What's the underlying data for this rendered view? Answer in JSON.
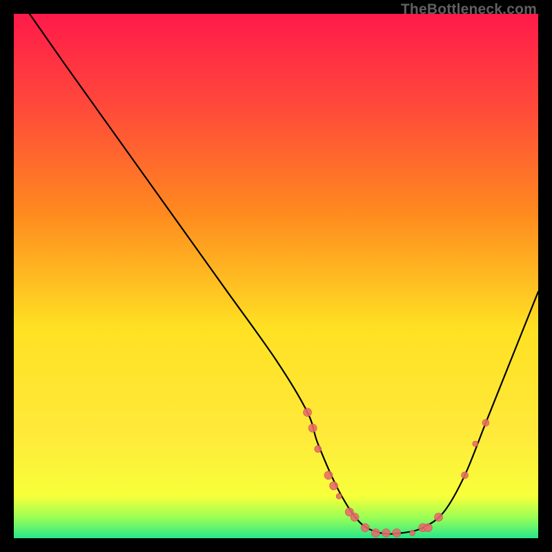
{
  "watermark": "TheBottleneck.com",
  "colors": {
    "frame_bg": "#000000",
    "gradient_top": "#ff1a4a",
    "gradient_mid1": "#ff8a1f",
    "gradient_mid2": "#ffe123",
    "gradient_low": "#f7ff3a",
    "gradient_green1": "#9cff55",
    "gradient_green2": "#27e88b",
    "curve": "#000000",
    "marker_fill": "#e86a6a",
    "marker_stroke": "#c94f4f"
  },
  "chart_data": {
    "type": "line",
    "title": "",
    "xlabel": "",
    "ylabel": "",
    "xlim": [
      0,
      100
    ],
    "ylim": [
      0,
      100
    ],
    "series": [
      {
        "name": "bottleneck-curve",
        "x": [
          3,
          10,
          20,
          30,
          40,
          50,
          56,
          58,
          62,
          66,
          70,
          74,
          78,
          82,
          86,
          90,
          94,
          100
        ],
        "y": [
          100,
          90,
          76,
          62,
          48,
          34,
          24,
          18,
          9,
          3,
          1,
          1,
          2,
          5,
          12,
          22,
          32,
          47
        ]
      }
    ],
    "markers": [
      {
        "x": 56,
        "y": 24,
        "r": 6
      },
      {
        "x": 57,
        "y": 21,
        "r": 6
      },
      {
        "x": 58,
        "y": 17,
        "r": 5
      },
      {
        "x": 60,
        "y": 12,
        "r": 6
      },
      {
        "x": 61,
        "y": 10,
        "r": 6
      },
      {
        "x": 62,
        "y": 8,
        "r": 4
      },
      {
        "x": 64,
        "y": 5,
        "r": 6
      },
      {
        "x": 65,
        "y": 4,
        "r": 6
      },
      {
        "x": 67,
        "y": 2,
        "r": 6
      },
      {
        "x": 69,
        "y": 1,
        "r": 6
      },
      {
        "x": 71,
        "y": 1,
        "r": 6
      },
      {
        "x": 73,
        "y": 1,
        "r": 6
      },
      {
        "x": 76,
        "y": 1,
        "r": 4
      },
      {
        "x": 78,
        "y": 2,
        "r": 6
      },
      {
        "x": 79,
        "y": 2,
        "r": 6
      },
      {
        "x": 81,
        "y": 4,
        "r": 6
      },
      {
        "x": 86,
        "y": 12,
        "r": 5
      },
      {
        "x": 88,
        "y": 18,
        "r": 4
      },
      {
        "x": 90,
        "y": 22,
        "r": 5
      }
    ]
  }
}
